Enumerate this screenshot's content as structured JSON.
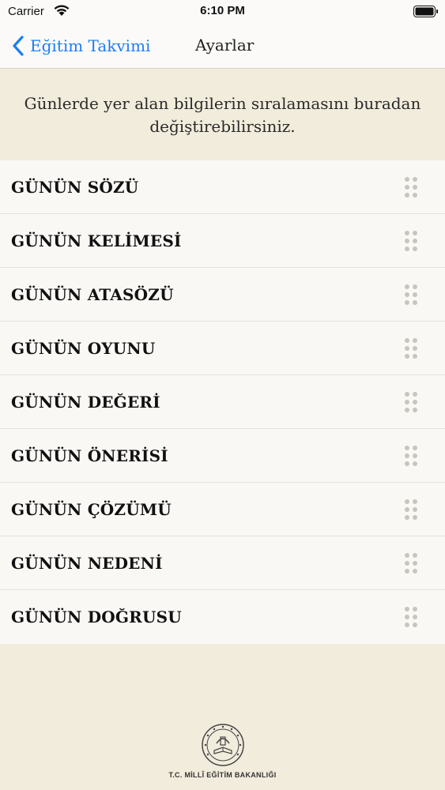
{
  "status_bar": {
    "carrier": "Carrier",
    "time": "6:10 PM"
  },
  "nav": {
    "back_label": "Eğitim Takvimi",
    "title": "Ayarlar"
  },
  "description": "Günlerde yer alan bilgilerin sıralamasını buradan değiştirebilirsiniz.",
  "items": [
    {
      "label": "GÜNÜN SÖZÜ"
    },
    {
      "label": "GÜNÜN KELİMESİ"
    },
    {
      "label": "GÜNÜN ATASÖZÜ"
    },
    {
      "label": "GÜNÜN OYUNU"
    },
    {
      "label": "GÜNÜN DEĞERİ"
    },
    {
      "label": "GÜNÜN ÖNERİSİ"
    },
    {
      "label": "GÜNÜN ÇÖZÜMÜ"
    },
    {
      "label": "GÜNÜN NEDENİ"
    },
    {
      "label": "GÜNÜN DOĞRUSU"
    }
  ],
  "footer": {
    "logo_icon": "meb-seal-icon",
    "text": "T.C. MİLLÎ EĞİTİM BAKANLIĞI"
  },
  "colors": {
    "accent": "#1a7ef0",
    "background": "#f2ecdc",
    "list_background": "#faf8f5"
  }
}
